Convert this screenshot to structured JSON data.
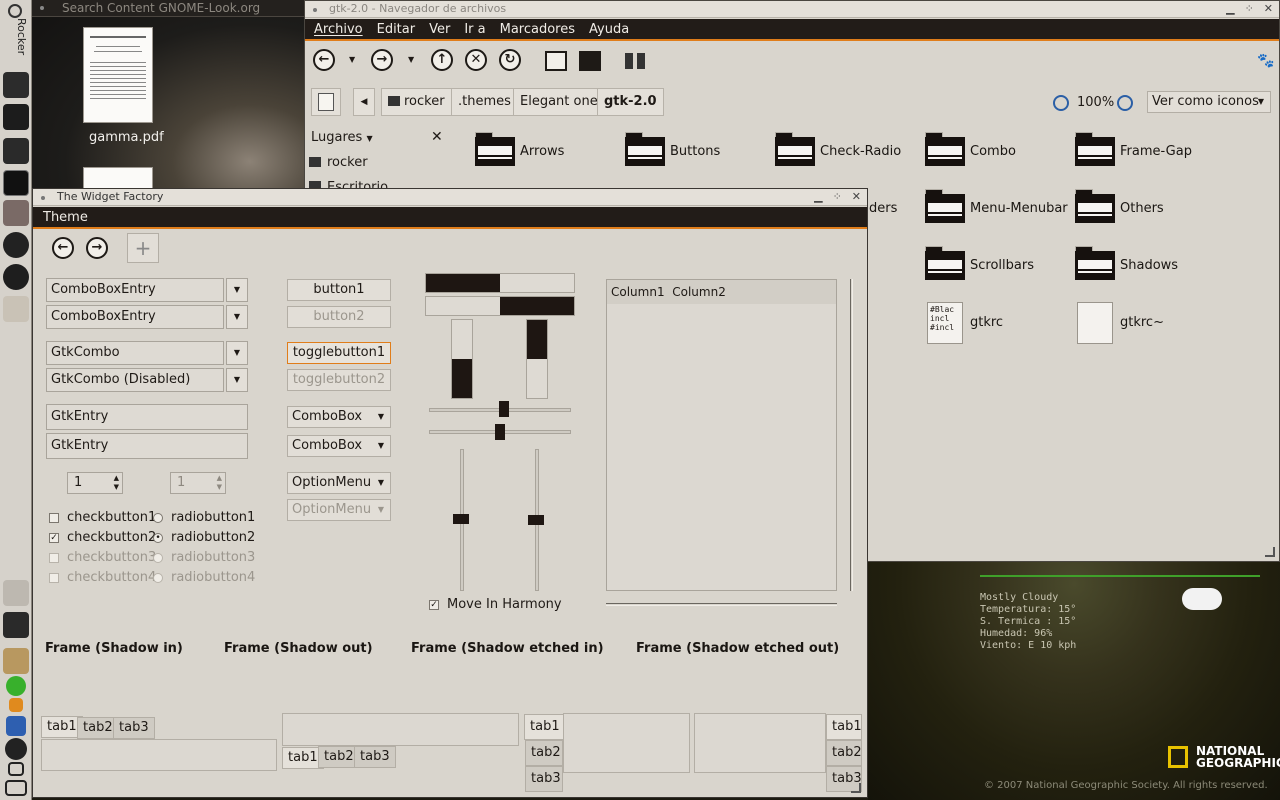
{
  "desktop": {
    "panel_label": "Rocker",
    "search_title": "Search Content GNOME-Look.org",
    "file1_label": "gamma.pdf"
  },
  "nautilus": {
    "title": "gtk-2.0 - Navegador de archivos",
    "menu": [
      "Archivo",
      "Editar",
      "Ver",
      "Ir a",
      "Marcadores",
      "Ayuda"
    ],
    "breadcrumbs": [
      "rocker",
      ".themes",
      "Elegant one",
      "gtk-2.0"
    ],
    "zoom": "100%",
    "view_mode": "Ver como iconos",
    "places_label": "Lugares",
    "places_items": [
      "rocker",
      "Escritorio"
    ],
    "partial_label": "ders",
    "folders": [
      "Arrows",
      "Buttons",
      "Check-Radio",
      "Combo",
      "Frame-Gap",
      "Menu-Menubar",
      "Others",
      "Scrollbars",
      "Shadows"
    ],
    "files": [
      {
        "name": "gtkrc",
        "preview": "#Blac\nincl\n#incl"
      },
      {
        "name": "gtkrc~",
        "preview": ""
      }
    ]
  },
  "weather": {
    "lines": [
      "Mostly Cloudy",
      "Temperatura: 15°",
      "S. Termica : 15°",
      "Humedad: 96%",
      "Viento: E 10 kph"
    ],
    "brand_line1": "NATIONAL",
    "brand_line2": "GEOGRAPHIC",
    "copyright": "© 2007 National Geographic Society. All rights reserved."
  },
  "widget_factory": {
    "title": "The Widget Factory",
    "menu": [
      "Theme"
    ],
    "combo_entries": [
      "ComboBoxEntry",
      "ComboBoxEntry"
    ],
    "gtk_combos": [
      "GtkCombo",
      "GtkCombo (Disabled)"
    ],
    "entries": [
      "GtkEntry",
      "GtkEntry"
    ],
    "spin_values": [
      "1",
      "1"
    ],
    "buttons": [
      "button1",
      "button2"
    ],
    "toggle_buttons": [
      "togglebutton1",
      "togglebutton2"
    ],
    "combo_boxes": [
      "ComboBox",
      "ComboBox"
    ],
    "option_menus": [
      "OptionMenu",
      "OptionMenu"
    ],
    "checkbuttons": [
      "checkbutton1",
      "checkbutton2",
      "checkbutton3",
      "checkbutton4"
    ],
    "radiobuttons": [
      "radiobutton1",
      "radiobutton2",
      "radiobutton3",
      "radiobutton4"
    ],
    "progress_horizontal": [
      0.5,
      0.5
    ],
    "progress_vertical": [
      0.5,
      0.5
    ],
    "move_in_harmony": "Move In Harmony",
    "tree_columns": [
      "Column1",
      "Column2"
    ],
    "frames": [
      "Frame (Shadow in)",
      "Frame (Shadow out)",
      "Frame (Shadow etched in)",
      "Frame (Shadow etched out)"
    ],
    "tabs": [
      "tab1",
      "tab2",
      "tab3"
    ]
  }
}
